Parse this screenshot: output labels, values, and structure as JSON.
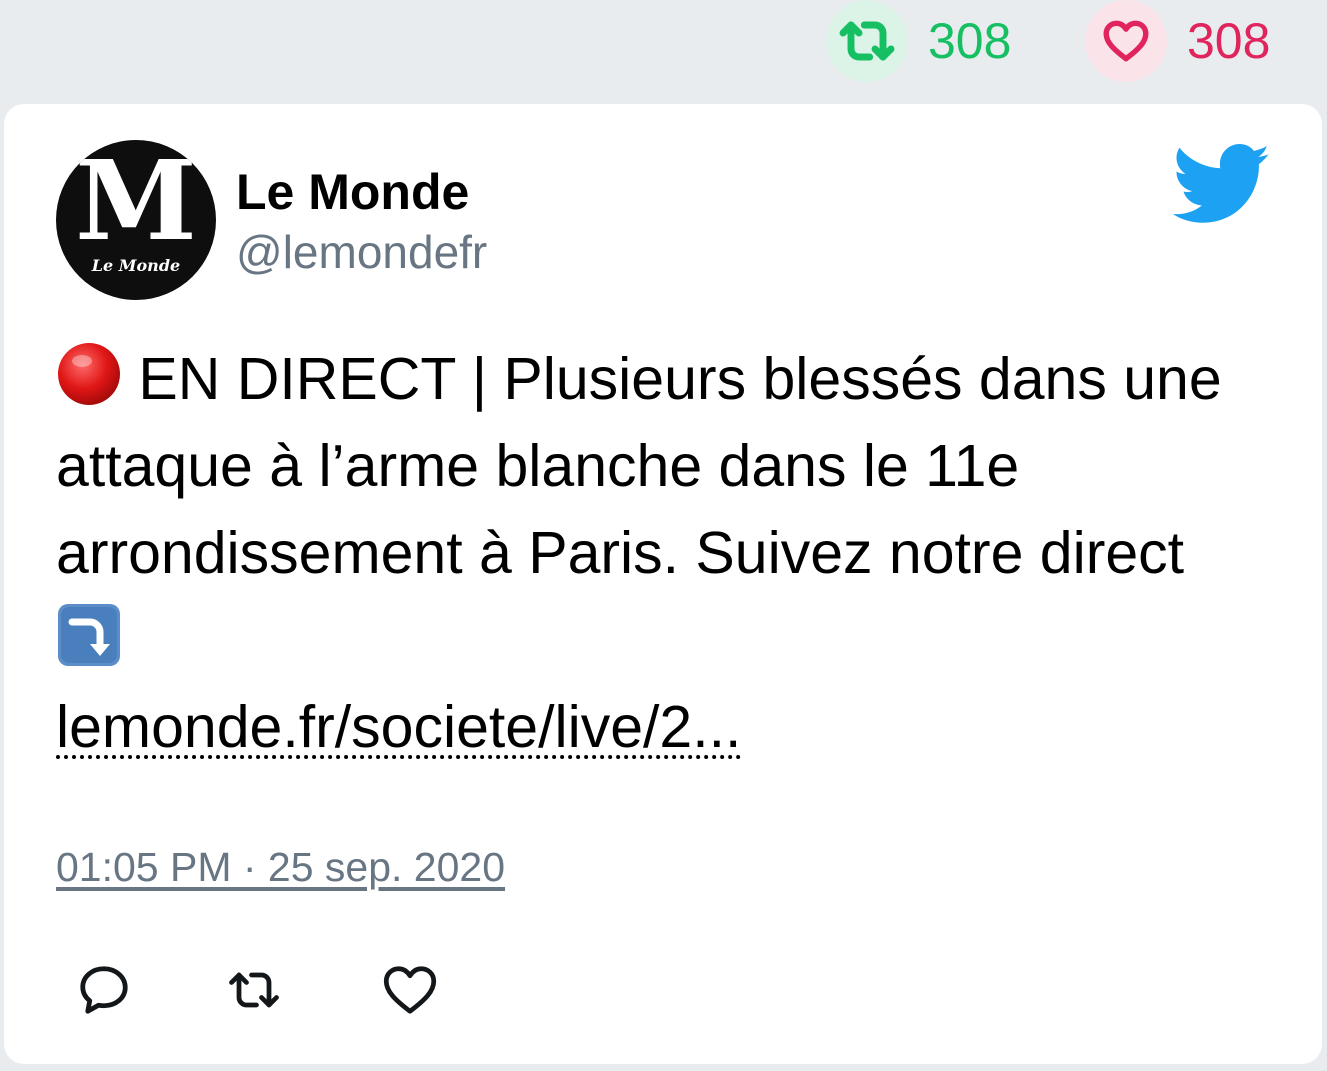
{
  "stats": {
    "retweets": "308",
    "likes": "308",
    "retweet_color": "#17bf63",
    "like_color": "#e0245e"
  },
  "account": {
    "name": "Le Monde",
    "handle": "@lemondefr",
    "avatar": {
      "monogram": "M",
      "wordmark": "Le Monde"
    }
  },
  "tweet": {
    "text_prefix_emoji": "red-circle-emoji",
    "text_line": "EN DIRECT | Plusieurs blessés dans une attaque à l’arme blanche dans le 11e arrondissement à Paris. Suivez notre direct",
    "text_suffix_emoji": "arrow-curving-down-emoji",
    "link": "lemonde.fr/societe/live/2...",
    "timestamp": "01:05 PM · 25 sep. 2020"
  },
  "icons": {
    "brand": "twitter-bird-icon",
    "actions": [
      "reply-icon",
      "retweet-icon",
      "like-icon"
    ]
  },
  "colors": {
    "twitter_blue": "#1da1f2",
    "secondary_text": "#687684"
  }
}
